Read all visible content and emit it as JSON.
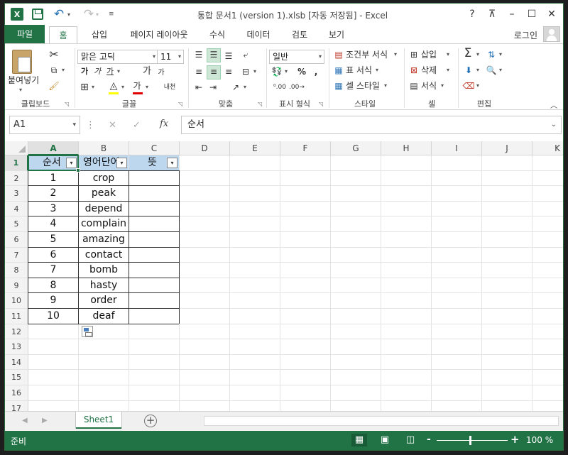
{
  "window": {
    "title": "통합 문서1 (version 1).xlsb [자동 저장됨] - Excel",
    "help": "?",
    "restore_ribbon": "⊼",
    "minimize": "–",
    "maximize": "☐",
    "close": "✕"
  },
  "ribbon_tabs": [
    {
      "label": "파일"
    },
    {
      "label": "홈"
    },
    {
      "label": "삽입"
    },
    {
      "label": "페이지 레이아웃"
    },
    {
      "label": "수식"
    },
    {
      "label": "데이터"
    },
    {
      "label": "검토"
    },
    {
      "label": "보기"
    }
  ],
  "account": {
    "login": "로그인"
  },
  "ribbon": {
    "clipboard": {
      "paste_label": "붙여넣기",
      "group": "클립보드"
    },
    "font": {
      "group": "글꼴",
      "name": "맑은 고딕",
      "size": "11",
      "bold": "가",
      "italic": "가",
      "underline": "가",
      "grow": "가",
      "shrink": "가",
      "phonetic": "내천",
      "font_color_glyph": "가"
    },
    "alignment": {
      "group": "맞춤"
    },
    "number": {
      "group": "표시 형식",
      "format": "일반",
      "percent": "%",
      "comma": ","
    },
    "styles": {
      "group": "스타일",
      "conditional": "조건부 서식",
      "as_table": "표 서식",
      "cell_styles": "셀 스타일"
    },
    "cells": {
      "group": "셀",
      "insert": "삽입",
      "delete": "삭제",
      "format": "서식"
    },
    "editing": {
      "group": "편집",
      "sum": "Σ"
    }
  },
  "formula_bar": {
    "name_box": "A1",
    "fx": "fx",
    "content": "순서"
  },
  "grid": {
    "columns": [
      "A",
      "B",
      "C",
      "D",
      "E",
      "F",
      "G",
      "H",
      "I",
      "J",
      "K"
    ],
    "rows": [
      "1",
      "2",
      "3",
      "4",
      "5",
      "6",
      "7",
      "8",
      "9",
      "10",
      "11",
      "12",
      "13",
      "14",
      "15",
      "16",
      "17"
    ],
    "table": {
      "headers": [
        "순서",
        "영어단어",
        "뜻"
      ],
      "data": [
        [
          "1",
          "crop",
          ""
        ],
        [
          "2",
          "peak",
          ""
        ],
        [
          "3",
          "depend",
          ""
        ],
        [
          "4",
          "complain",
          ""
        ],
        [
          "5",
          "amazing",
          ""
        ],
        [
          "6",
          "contact",
          ""
        ],
        [
          "7",
          "bomb",
          ""
        ],
        [
          "8",
          "hasty",
          ""
        ],
        [
          "9",
          "order",
          ""
        ],
        [
          "10",
          "deaf",
          ""
        ]
      ]
    }
  },
  "sheets": {
    "active": "Sheet1",
    "add": "+"
  },
  "status": {
    "ready": "준비",
    "zoom": "100 %",
    "zoom_minus": "-",
    "zoom_plus": "+"
  },
  "colors": {
    "accent": "#217346",
    "header_fill": "#BDD7EE"
  }
}
